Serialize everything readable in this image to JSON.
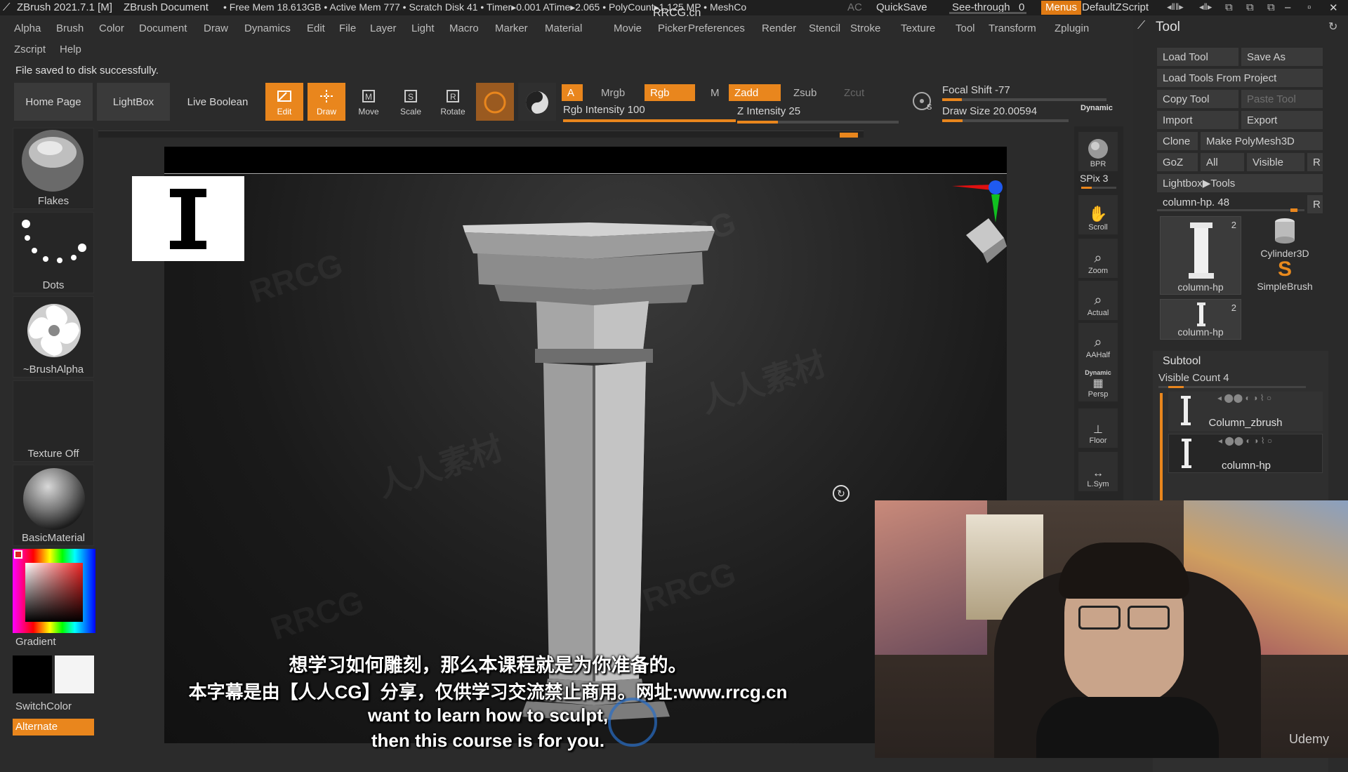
{
  "titlebar": {
    "app": "ZBrush 2021.7.1 [M]",
    "doc": "ZBrush Document",
    "stats": "• Free Mem 18.613GB • Active Mem 777 • Scratch Disk 41 • Timer▸0.001 ATime▸2.065 • PolyCount▸1.125 MP • MeshCo",
    "ac": "AC",
    "quicksave": "QuickSave",
    "seethrough": "See-through",
    "seethrough_value": "0",
    "menus": "Menus",
    "script": "DefaultZScript"
  },
  "menubar": {
    "row1": [
      "Alpha",
      "Brush",
      "Color",
      "Document",
      "Draw",
      "Dynamics",
      "Edit",
      "File",
      "Layer",
      "Light",
      "Macro",
      "Marker",
      "Material",
      "Movie",
      "Picker",
      "Preferences",
      "Render",
      "Stencil",
      "Stroke",
      "Texture",
      "Tool",
      "Transform",
      "Zplugin"
    ],
    "row2": [
      "Zscript",
      "Help"
    ]
  },
  "status": "File saved to disk successfully.",
  "shelf": {
    "home": "Home Page",
    "lightbox": "LightBox",
    "liveboolean": "Live Boolean",
    "edit": "Edit",
    "draw": "Draw",
    "move": "Move",
    "scale": "Scale",
    "rotate": "Rotate",
    "a": "A",
    "mrgb": "Mrgb",
    "rgb": "Rgb",
    "m": "M",
    "zadd": "Zadd",
    "zsub": "Zsub",
    "zcut": "Zcut",
    "rgb_intensity": "Rgb Intensity 100",
    "z_intensity": "Z Intensity 25",
    "focal_shift": "Focal Shift -77",
    "draw_size": "Draw Size 20.00594",
    "dynamic": "Dynamic",
    "rgb_intensity_level": 1.0,
    "z_intensity_level": 0.25
  },
  "leftshelf": {
    "flakes": "Flakes",
    "dots": "Dots",
    "brushalpha": "~BrushAlpha",
    "texture": "Texture Off",
    "material": "BasicMaterial",
    "gradient": "Gradient",
    "switchcolor": "SwitchColor",
    "alternate": "Alternate"
  },
  "righttools": {
    "bpr": "BPR",
    "spix": "SPix 3",
    "scroll": "Scroll",
    "zoom": "Zoom",
    "actual": "Actual",
    "aahalf": "AAHalf",
    "dynamic": "Dynamic",
    "persp": "Persp",
    "floor": "Floor",
    "lsym": "L.Sym"
  },
  "toolpanel": {
    "title": "Tool",
    "load_tool": "Load Tool",
    "save_as": "Save As",
    "load_from_project": "Load Tools From Project",
    "copy_tool": "Copy Tool",
    "paste_tool": "Paste Tool",
    "import": "Import",
    "export": "Export",
    "clone": "Clone",
    "make_polymesh": "Make PolyMesh3D",
    "goz": "GoZ",
    "all": "All",
    "visible": "Visible",
    "r": "R",
    "lightbox_tools": "Lightbox▶Tools",
    "current_tool": "column-hp. 48",
    "thumbs": [
      {
        "name": "column-hp",
        "count": "2"
      },
      {
        "name": "Cylinder3D",
        "count": ""
      },
      {
        "name": "SimpleBrush",
        "count": ""
      },
      {
        "name": "column-hp",
        "count": "2"
      }
    ],
    "subtool": "Subtool",
    "visible_count": "Visible Count 4",
    "subtools": [
      "Column_zbrush",
      "column-hp"
    ]
  },
  "subtitles": {
    "zh1": "想学习如何雕刻，那么本课程就是为你准备的。",
    "zh2": "本字幕是由【人人CG】分享，仅供学习交流禁止商用。网址:www.rrcg.cn",
    "en1": "want to learn how to sculpt,",
    "en2": "then this course is for you."
  },
  "watermark": {
    "top": "RRCG.cn",
    "brand": "RRCG",
    "cn": "人人素材",
    "udemy": "Udemy"
  },
  "colors": {
    "accent": "#e9861d",
    "bg": "#2b2b2b"
  }
}
